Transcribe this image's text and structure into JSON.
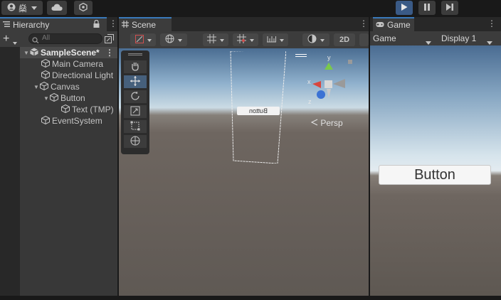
{
  "toolbar": {
    "account_label": "燊",
    "play_icon": "play-icon",
    "pause_icon": "pause-icon",
    "step_icon": "step-icon",
    "accent": "#3a79bb"
  },
  "hierarchy": {
    "tab_label": "Hierarchy",
    "add_label": "+",
    "search_placeholder": "All",
    "items": [
      {
        "label": "SampleScene*",
        "depth": 0,
        "expanded": true
      },
      {
        "label": "Main Camera",
        "depth": 1
      },
      {
        "label": "Directional Light",
        "depth": 1
      },
      {
        "label": "Canvas",
        "depth": 1,
        "expanded": true
      },
      {
        "label": "Button",
        "depth": 2,
        "expanded": true
      },
      {
        "label": "Text (TMP)",
        "depth": 3
      },
      {
        "label": "EventSystem",
        "depth": 1
      }
    ]
  },
  "scene": {
    "tab_label": "Scene",
    "toolbar": {
      "twod_label": "2D"
    },
    "canvas_button_label": "Button",
    "persp_label": "Persp",
    "gizmo": {
      "y": "y",
      "x": "x",
      "z": "z"
    }
  },
  "game": {
    "tab_label": "Game",
    "mode_label": "Game",
    "display_label": "Display 1",
    "button_label": "Button"
  }
}
